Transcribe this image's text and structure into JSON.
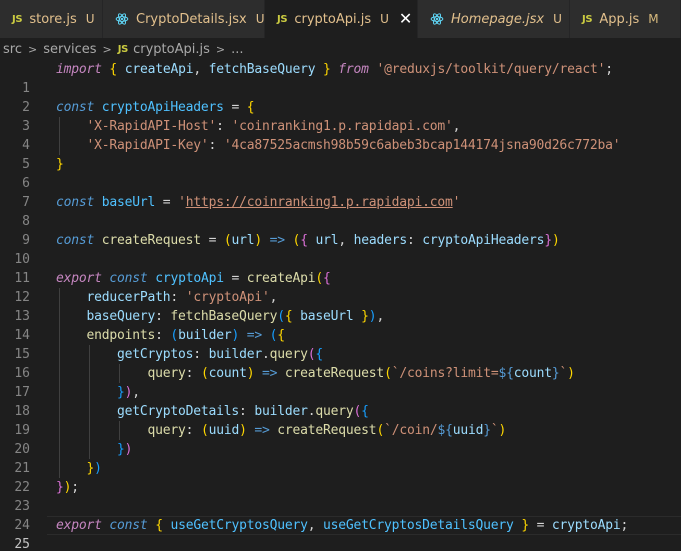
{
  "tabs": [
    {
      "name": "store.js",
      "status": "U",
      "icon": "js-icon",
      "active": false
    },
    {
      "name": "CryptoDetails.jsx",
      "status": "U",
      "icon": "react-icon",
      "active": false
    },
    {
      "name": "cryptoApi.js",
      "status": "U",
      "icon": "js-icon",
      "active": true,
      "close": "✕"
    },
    {
      "name": "Homepage.jsx",
      "status": "U",
      "icon": "react-icon",
      "active": false
    },
    {
      "name": "App.js",
      "status": "M",
      "icon": "js-icon",
      "active": false
    }
  ],
  "js_badge": "JS",
  "breadcrumb": {
    "parts": [
      "src",
      "services",
      "cryptoApi.js",
      "..."
    ]
  },
  "editor": {
    "line_numbers": [
      "1",
      "2",
      "3",
      "4",
      "5",
      "6",
      "7",
      "8",
      "9",
      "10",
      "11",
      "12",
      "13",
      "14",
      "15",
      "16",
      "17",
      "18",
      "19",
      "20",
      "21",
      "22",
      "23",
      "24",
      "25"
    ],
    "current_line": "25",
    "tokens": {
      "import": "import",
      "from": "from",
      "const": "const",
      "export": "export",
      "createApi": "createApi",
      "fetchBaseQuery": "fetchBaseQuery",
      "module": "'@reduxjs/toolkit/query/react'",
      "cryptoApiHeaders": "cryptoApiHeaders",
      "hostKey": "'X-RapidAPI-Host'",
      "hostVal": "'coinranking1.p.rapidapi.com'",
      "apiKey": "'X-RapidAPI-Key'",
      "apiVal": "'4ca87525acmsh98b59c6abeb3bcap144174jsna90d26c772ba'",
      "baseUrl": "baseUrl",
      "baseUrlQuoteL": "'",
      "baseUrlVal": "https://coinranking1.p.rapidapi.com",
      "baseUrlQuoteR": "'",
      "createRequest": "createRequest",
      "url": "url",
      "headers": "headers",
      "cryptoApi": "cryptoApi",
      "reducerPath": "reducerPath",
      "cryptoApiStr": "'cryptoApi'",
      "baseQuery": "baseQuery",
      "endpoints": "endpoints",
      "builder": "builder",
      "getCryptos": "getCryptos",
      "query": "query",
      "count": "count",
      "coinsTplA": "`/coins?limit=",
      "tplOpen": "${",
      "tplClose": "}",
      "tplEnd": "`",
      "getCryptoDetails": "getCryptoDetails",
      "uuid": "uuid",
      "coinTplA": "`/coin/",
      "useGetCryptosQuery": "useGetCryptosQuery",
      "useGetCryptosDetailsQuery": "useGetCryptosDetailsQuery"
    }
  }
}
